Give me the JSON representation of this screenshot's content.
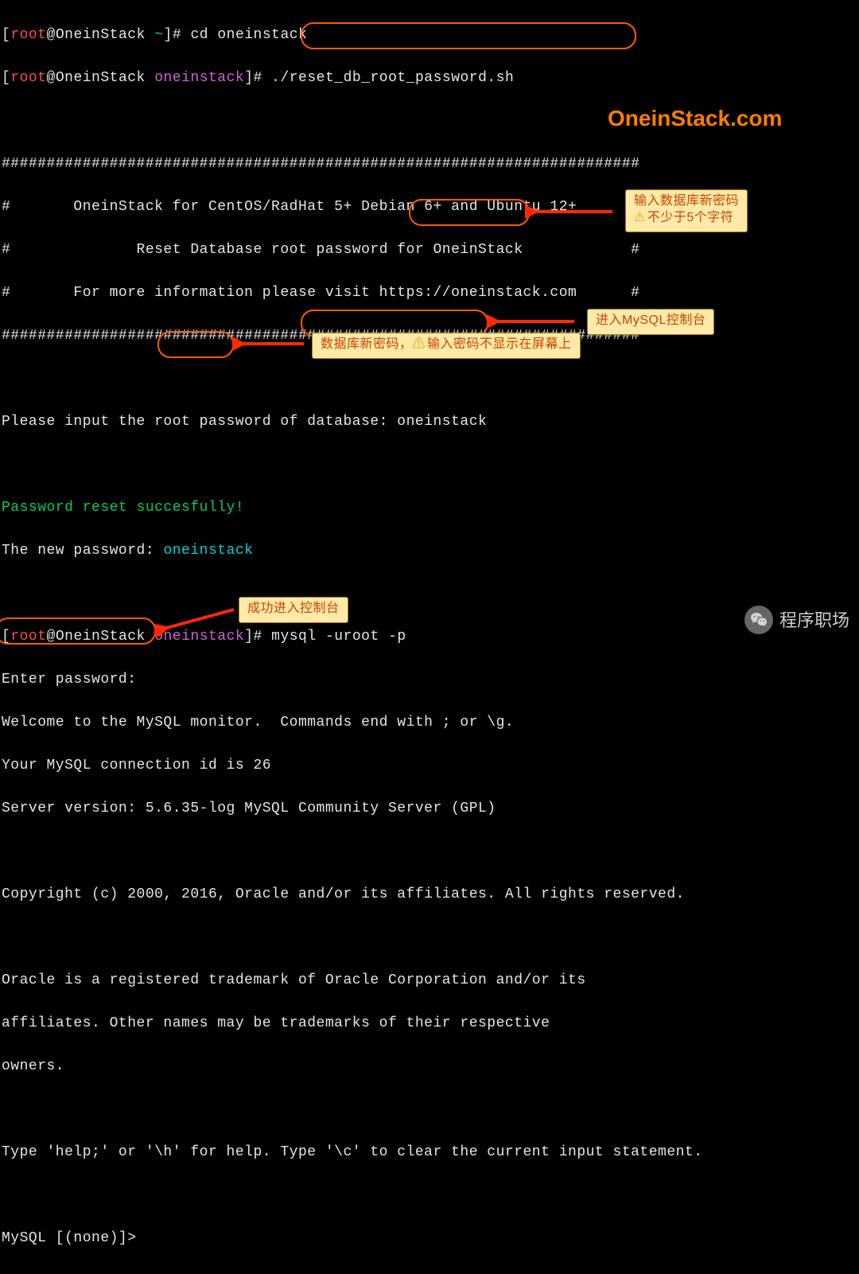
{
  "prompt1": {
    "user": "root",
    "host": "OneinStack",
    "dir": "~",
    "symbol": "#",
    "cmd": "cd oneinstack"
  },
  "prompt2": {
    "user": "root",
    "host": "OneinStack",
    "dir": "oneinstack",
    "symbol": "#",
    "cmd": "./reset_db_root_password.sh"
  },
  "banner": {
    "rule": "#######################################################################",
    "l1": "#       OneinStack for CentOS/RadHat 5+ Debian 6+ and Ubuntu 12+      #",
    "l2": "#              Reset Database root password for OneinStack            #",
    "l3": "#       For more information please visit https://oneinstack.com      #"
  },
  "input_label": "Please input the root password of database: ",
  "input_value": "oneinstack",
  "reset_ok": "Password reset succesfully! ",
  "new_pwd_label": "The new password: ",
  "new_pwd_value": "oneinstack",
  "prompt3": {
    "user": "root",
    "host": "OneinStack",
    "dir": "oneinstack",
    "symbol": "#",
    "cmd": "mysql -uroot -p"
  },
  "enter_pwd": "Enter password: ",
  "mysql_welcome": [
    "Welcome to the MySQL monitor.  Commands end with ; or \\g.",
    "Your MySQL connection id is 26",
    "Server version: 5.6.35-log MySQL Community Server (GPL)",
    "",
    "Copyright (c) 2000, 2016, Oracle and/or its affiliates. All rights reserved.",
    "",
    "Oracle is a registered trademark of Oracle Corporation and/or its",
    "affiliates. Other names may be trademarks of their respective",
    "owners.",
    "",
    "Type 'help;' or '\\h' for help. Type '\\c' to clear the current input statement."
  ],
  "mysql_prompt_a": "MySQL [(none)]",
  "mysql_prompt_b": "> ",
  "callouts": {
    "pwd_new_1": "输入数据库新密码",
    "pwd_new_2": "不少于5个字符",
    "mysql_console": "进入MySQL控制台",
    "hidden_pwd_a": "数据库新密码，",
    "hidden_pwd_b": "输入密码不显示在屏幕上",
    "success": "成功进入控制台"
  },
  "watermark_site": "OneinStack.com",
  "watermark_footer": "程序职场"
}
